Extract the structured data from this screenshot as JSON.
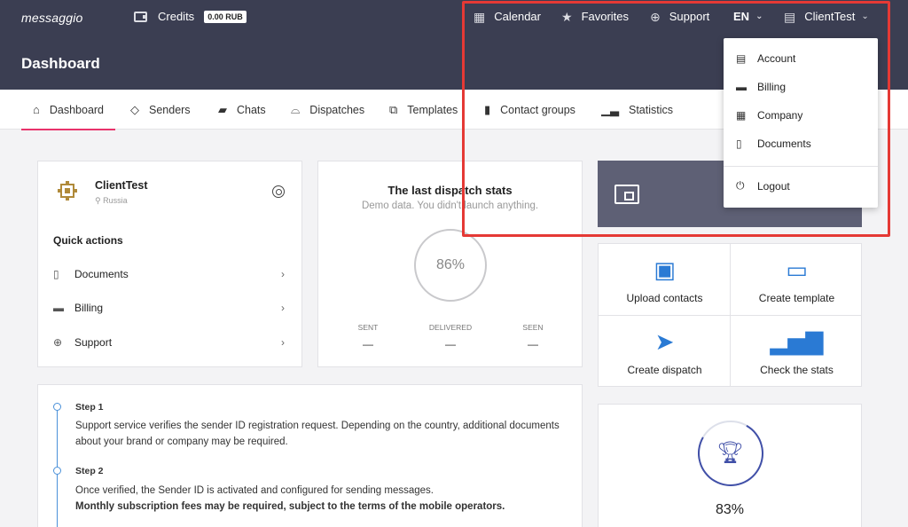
{
  "header": {
    "logo": "messaggio",
    "credits_label": "Credits",
    "credits_badge": "0.00 RUB",
    "page_title": "Dashboard",
    "calendar": "Calendar",
    "favorites": "Favorites",
    "support": "Support",
    "language": "EN",
    "user": "ClientTest"
  },
  "tabs": [
    {
      "label": "Dashboard",
      "icon": "home-icon",
      "active": true
    },
    {
      "label": "Senders",
      "icon": "tag-icon"
    },
    {
      "label": "Chats",
      "icon": "chat-icon"
    },
    {
      "label": "Dispatches",
      "icon": "inbox-icon"
    },
    {
      "label": "Templates",
      "icon": "copy-icon"
    },
    {
      "label": "Contact groups",
      "icon": "contacts-icon"
    },
    {
      "label": "Statistics",
      "icon": "bar-chart-icon"
    }
  ],
  "client_card": {
    "name": "ClientTest",
    "location": "Russia",
    "quick_actions_title": "Quick actions",
    "items": [
      {
        "label": "Documents",
        "icon": "document-icon"
      },
      {
        "label": "Billing",
        "icon": "wallet-icon"
      },
      {
        "label": "Support",
        "icon": "lifebuoy-icon"
      }
    ]
  },
  "stats_card": {
    "title": "The last dispatch stats",
    "subtitle": "Demo data. You didn't launch anything.",
    "percent": "86%",
    "metrics": [
      {
        "label": "SENT",
        "value": "—"
      },
      {
        "label": "DELIVERED",
        "value": "—"
      },
      {
        "label": "SEEN",
        "value": "—"
      }
    ]
  },
  "actions": [
    {
      "label": "Upload contacts",
      "icon": "contacts-book-icon"
    },
    {
      "label": "Create template",
      "icon": "chat-bubble-icon"
    },
    {
      "label": "Create dispatch",
      "icon": "paper-plane-icon"
    },
    {
      "label": "Check the stats",
      "icon": "bar-chart-icon"
    }
  ],
  "trophy_card": {
    "percent": "83%",
    "icon": "trophy-icon"
  },
  "steps": [
    {
      "title": "Step 1",
      "text": "Support service verifies the sender ID registration request. Depending on the country, additional documents about your brand or company may be required."
    },
    {
      "title": "Step 2",
      "text": "Once verified, the Sender ID is activated and configured for sending messages.",
      "bold_text": "Monthly subscription fees may be required, subject to the terms of the mobile operators."
    }
  ],
  "user_menu": {
    "items": [
      {
        "label": "Account",
        "icon": "id-card-icon"
      },
      {
        "label": "Billing",
        "icon": "wallet-icon"
      },
      {
        "label": "Company",
        "icon": "building-icon"
      },
      {
        "label": "Documents",
        "icon": "document-icon"
      }
    ],
    "logout": "Logout"
  },
  "colors": {
    "header_bg": "#3b3e52",
    "active_tab": "#e8336b",
    "accent_blue": "#2a7ad4",
    "highlight_box": "#e53935"
  }
}
